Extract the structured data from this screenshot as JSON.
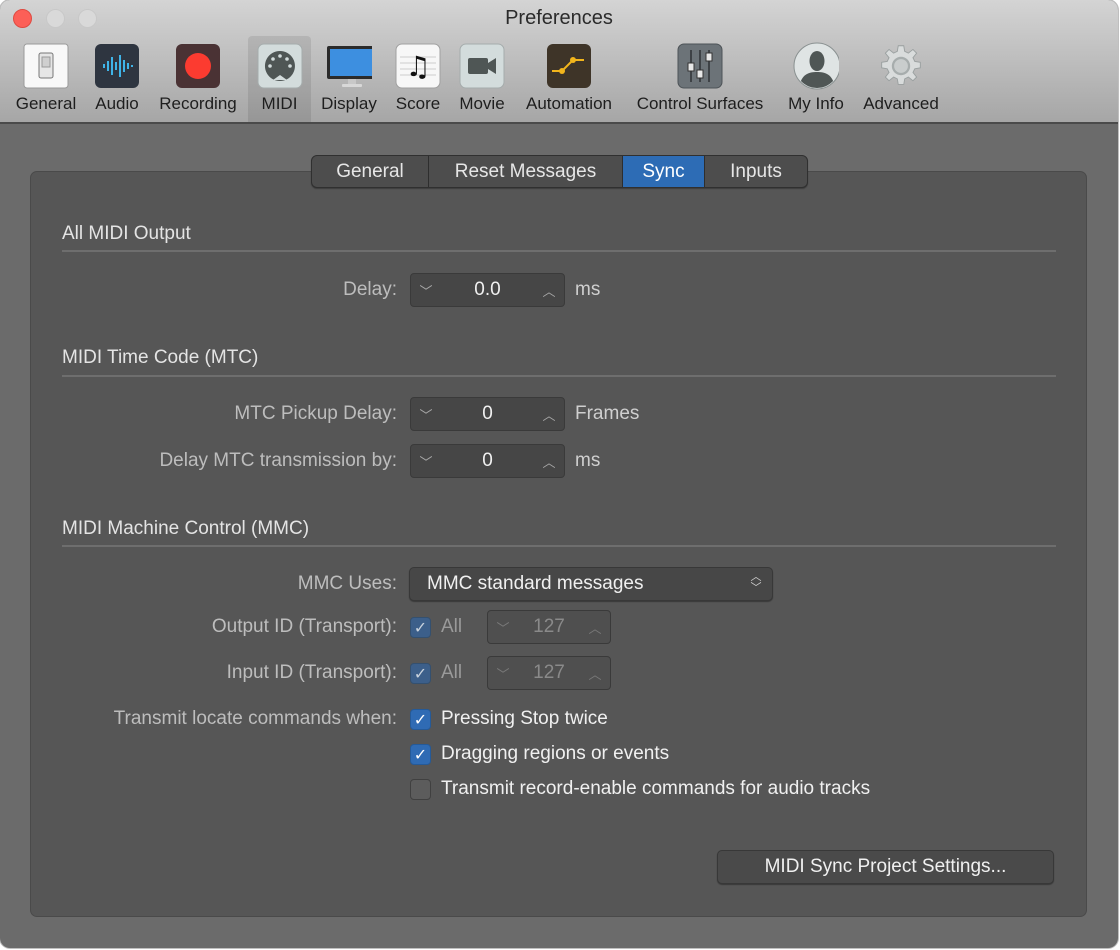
{
  "window": {
    "title": "Preferences"
  },
  "toolbar": {
    "items": [
      {
        "label": "General",
        "icon": "switch-icon"
      },
      {
        "label": "Audio",
        "icon": "waveform-icon"
      },
      {
        "label": "Recording",
        "icon": "record-icon"
      },
      {
        "label": "MIDI",
        "icon": "midi-connector-icon",
        "active": true
      },
      {
        "label": "Display",
        "icon": "monitor-icon"
      },
      {
        "label": "Score",
        "icon": "music-note-icon"
      },
      {
        "label": "Movie",
        "icon": "video-camera-icon"
      },
      {
        "label": "Automation",
        "icon": "automation-curve-icon"
      },
      {
        "label": "Control Surfaces",
        "icon": "faders-icon"
      },
      {
        "label": "My Info",
        "icon": "person-icon"
      },
      {
        "label": "Advanced",
        "icon": "gear-icon"
      }
    ]
  },
  "tabs": [
    {
      "label": "General"
    },
    {
      "label": "Reset Messages"
    },
    {
      "label": "Sync",
      "selected": true
    },
    {
      "label": "Inputs"
    }
  ],
  "sections": {
    "all_midi_output": {
      "title": "All MIDI Output",
      "delay": {
        "label": "Delay:",
        "value": "0.0",
        "unit": "ms"
      }
    },
    "mtc": {
      "title": "MIDI Time Code (MTC)",
      "pickup_delay": {
        "label": "MTC Pickup Delay:",
        "value": "0",
        "unit": "Frames"
      },
      "transmission_delay": {
        "label": "Delay MTC transmission by:",
        "value": "0",
        "unit": "ms"
      }
    },
    "mmc": {
      "title": "MIDI Machine Control (MMC)",
      "uses": {
        "label": "MMC Uses:",
        "value": "MMC standard messages"
      },
      "output_id": {
        "label": "Output ID (Transport):",
        "all_label": "All",
        "all_checked": true,
        "value": "127"
      },
      "input_id": {
        "label": "Input ID (Transport):",
        "all_label": "All",
        "all_checked": true,
        "value": "127"
      },
      "transmit_locate": {
        "label": "Transmit locate commands when:",
        "options": [
          {
            "label": "Pressing Stop twice",
            "checked": true
          },
          {
            "label": "Dragging regions or events",
            "checked": true
          },
          {
            "label": "Transmit record-enable commands for audio tracks",
            "checked": false
          }
        ]
      }
    }
  },
  "buttons": {
    "project_settings": "MIDI Sync Project Settings..."
  },
  "colors": {
    "accent": "#2d6cb5",
    "panel": "#565656",
    "window_bg": "#6b6b6b"
  }
}
